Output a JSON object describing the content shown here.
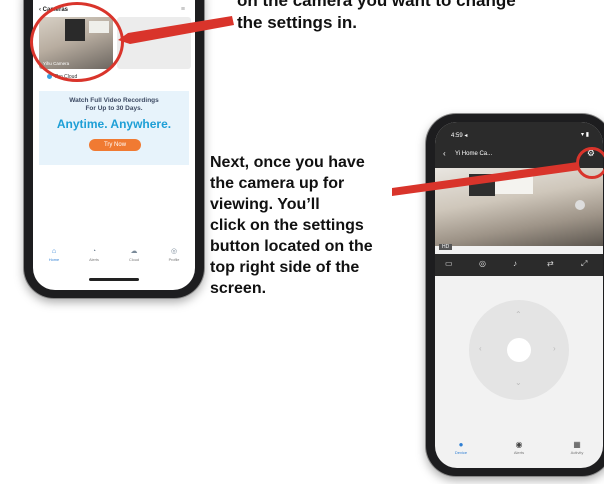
{
  "instructions": {
    "top_text": "on the camera you want to change\nthe settings in.",
    "main_text": "Next, once you have\nthe camera up for\nviewing. You’ll\nclick on the settings\nbutton located on the\ntop right side of the\nscreen."
  },
  "phone1": {
    "header": {
      "back": "‹",
      "title": "Cameras",
      "menu": "≡"
    },
    "camera_label": "Yihu Camera",
    "pro_label": "Pro Cloud",
    "promo": {
      "line1": "Watch Full Video Recordings",
      "line2": "For Up to 30 Days.",
      "headline": "Anytime. Anywhere.",
      "button": "Try Now"
    },
    "tabs": [
      {
        "icon": "⌂",
        "label": "Home"
      },
      {
        "icon": "◔",
        "label": "Alerts"
      },
      {
        "icon": "☁",
        "label": "Cloud"
      },
      {
        "icon": "◎",
        "label": "Profile"
      }
    ]
  },
  "phone2": {
    "status": {
      "time": "4:59 ◂",
      "icons": "▾ ▮"
    },
    "header": {
      "back": "‹",
      "title": "Yi Home Ca...",
      "settings": "⚙"
    },
    "hd_label": "HD",
    "controls": [
      "▭",
      "◎",
      "♪",
      "⇄",
      "⤢"
    ],
    "dpad": {
      "up": "⌃",
      "down": "⌄",
      "left": "‹",
      "right": "›"
    },
    "tabs": [
      {
        "icon": "●",
        "label": "Device"
      },
      {
        "icon": "◉",
        "label": "Alerts"
      },
      {
        "icon": "▦",
        "label": "Activity"
      }
    ]
  },
  "colors": {
    "highlight_red": "#d9342b",
    "accent_blue": "#1e9fd6",
    "button_orange": "#f07a32"
  }
}
